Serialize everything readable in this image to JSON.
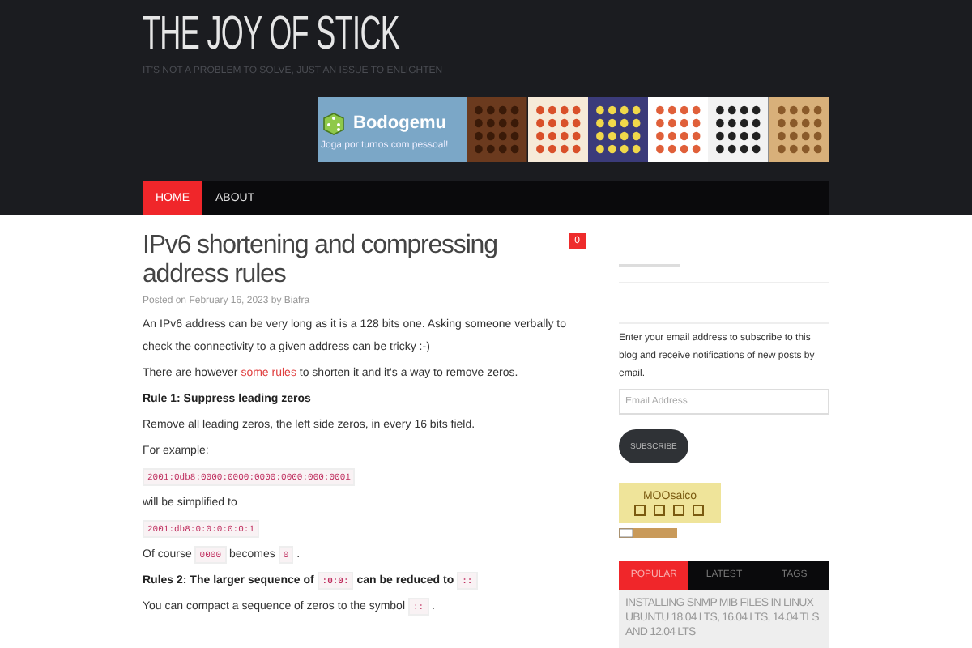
{
  "site": {
    "title": "THE JOY OF STICK",
    "tagline": "IT'S NOT A PROBLEM TO SOLVE, JUST AN ISSUE TO ENLIGHTEN"
  },
  "banner": {
    "brand": "Bodogemu",
    "slogan": "Joga por turnos com pessoal!"
  },
  "nav": [
    {
      "label": "HOME",
      "selected": true
    },
    {
      "label": "ABOUT",
      "selected": false
    }
  ],
  "post": {
    "title": "IPv6 shortening and compressing address rules",
    "comments": "0",
    "meta": "Posted on February 16, 2023 by Biafra",
    "blocks": [
      {
        "kind": "p",
        "parts": [
          {
            "kind": "text",
            "text": "An IPv6 address can be very long as it is a 128 bits one. Asking someone verbally to check the connectivity to a given address can be tricky :-)"
          }
        ]
      },
      {
        "kind": "p",
        "parts": [
          {
            "kind": "text",
            "text": "There are however"
          },
          {
            "kind": "link",
            "text": "some rules"
          },
          {
            "kind": "text",
            "text": "to shorten it and it's a way to remove zeros."
          }
        ]
      },
      {
        "kind": "heading",
        "parts": [
          {
            "kind": "text",
            "text": "Rule 1: Suppress leading zeros"
          }
        ]
      },
      {
        "kind": "p",
        "parts": [
          {
            "kind": "text",
            "text": "Remove all leading zeros, the left side zeros, in every 16 bits field."
          }
        ]
      },
      {
        "kind": "p",
        "parts": [
          {
            "kind": "text",
            "text": "For example:"
          }
        ]
      },
      {
        "kind": "p",
        "parts": [
          {
            "kind": "code",
            "text": "2001:0db8:0000:0000:0000:0000:000:0001"
          }
        ]
      },
      {
        "kind": "p",
        "parts": [
          {
            "kind": "text",
            "text": "will be simplified to"
          }
        ]
      },
      {
        "kind": "p",
        "parts": [
          {
            "kind": "code",
            "text": "2001:db8:0:0:0:0:0:1"
          }
        ]
      },
      {
        "kind": "p",
        "parts": [
          {
            "kind": "text",
            "text": "Of course"
          },
          {
            "kind": "code",
            "text": "0000"
          },
          {
            "kind": "text",
            "text": "becomes"
          },
          {
            "kind": "code",
            "text": "0"
          },
          {
            "kind": "text",
            "text": "."
          }
        ]
      },
      {
        "kind": "heading",
        "parts": [
          {
            "kind": "text",
            "text": "Rules 2: The larger sequence of"
          },
          {
            "kind": "code",
            "text": ":0:0:"
          },
          {
            "kind": "text",
            "text": "can be reduced to"
          },
          {
            "kind": "code",
            "text": "::"
          }
        ]
      },
      {
        "kind": "p",
        "parts": [
          {
            "kind": "text",
            "text": "You can compact a sequence of zeros to the symbol"
          },
          {
            "kind": "code",
            "text": "::"
          },
          {
            "kind": "text",
            "text": "."
          }
        ]
      }
    ]
  },
  "sidebar": {
    "subscribe_text": "Enter your email address to subscribe to this blog and receive notifications of new posts by email.",
    "email_placeholder": "Email Address",
    "subscribe_button": "SUBSCRIBE",
    "logo": "MOOsaico",
    "tabs": [
      {
        "label": "POPULAR",
        "selected": true
      },
      {
        "label": "LATEST",
        "selected": false
      },
      {
        "label": "TAGS",
        "selected": false
      }
    ],
    "posts": [
      "INSTALLING SNMP MIB FILES IN LINUX UBUNTU 18.04 LTS, 16.04 LTS, 14.04 TLS AND 12.04 LTS"
    ]
  }
}
